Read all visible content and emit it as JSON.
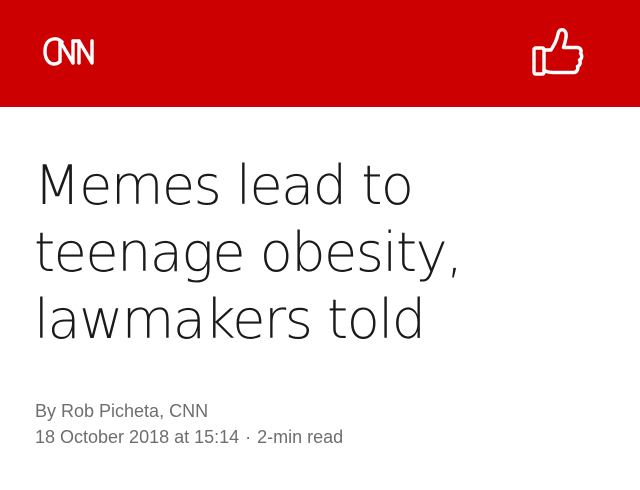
{
  "brand": {
    "name": "CNN",
    "logo_icon": "cnn-logo",
    "color": "#cc0000"
  },
  "header": {
    "like_icon": "thumbs-up-icon"
  },
  "article": {
    "headline_lines": [
      "Memes lead to",
      "teenage obesity,",
      "lawmakers told"
    ],
    "byline": "By Rob Picheta, CNN",
    "date": "18 October 2018 at 15:14",
    "separator": "·",
    "read_time": "2-min read"
  }
}
